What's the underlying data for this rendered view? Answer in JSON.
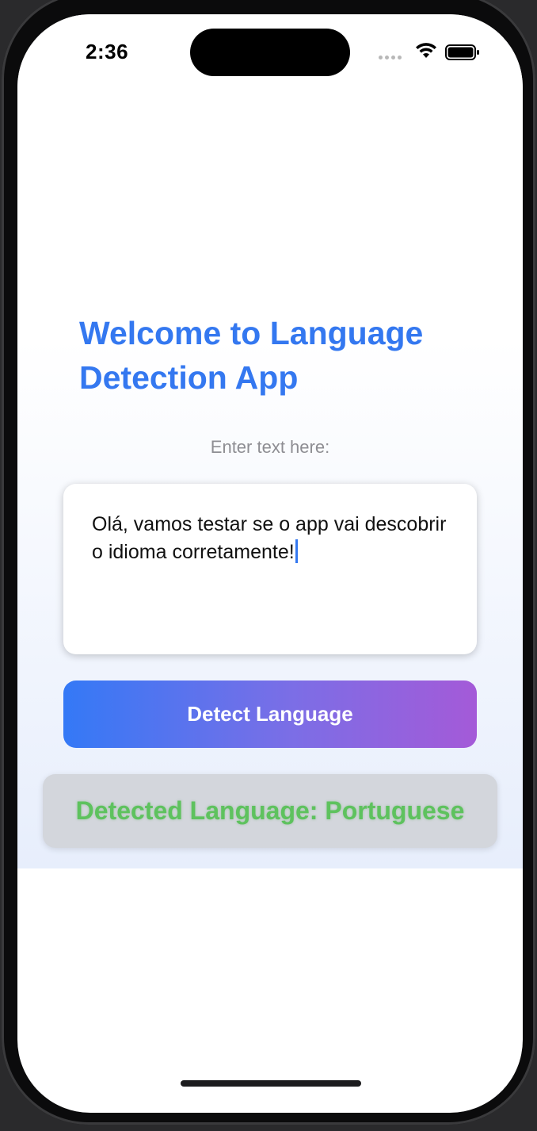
{
  "status_bar": {
    "time": "2:36"
  },
  "main": {
    "title": "Welcome to Language Detection App",
    "prompt_label": "Enter text here:",
    "input_text": "Olá, vamos testar se o app vai descobrir o idioma corretamente!",
    "detect_button_label": "Detect Language",
    "result_text": "Detected Language: Portuguese"
  },
  "colors": {
    "title": "#3478f0",
    "button_gradient_start": "#3479f6",
    "button_gradient_end": "#a45ad8",
    "result_text": "#5ec25e",
    "result_background": "#d3d6dc"
  },
  "icons": [
    "cellular-signal-icon",
    "wifi-icon",
    "battery-icon"
  ]
}
